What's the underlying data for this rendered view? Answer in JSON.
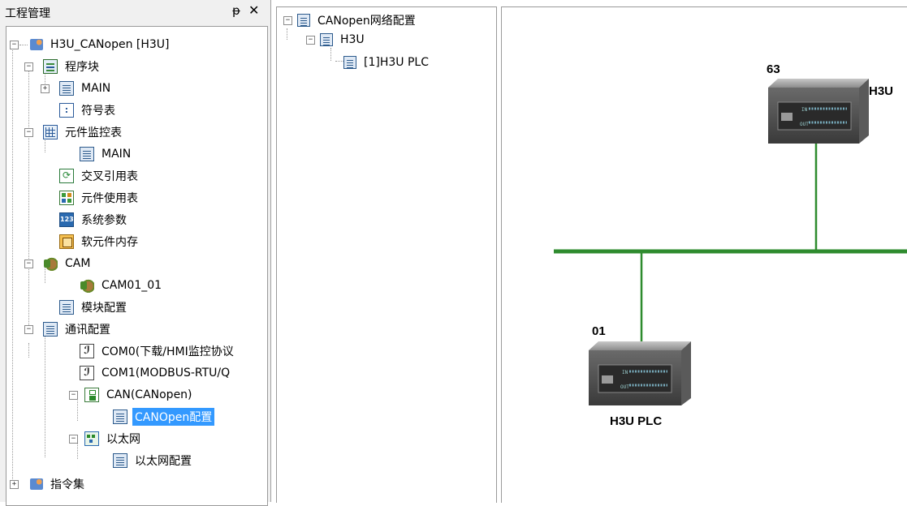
{
  "project_panel": {
    "title": "工程管理",
    "pin_glyph": "ᵽ",
    "close_glyph": "✕",
    "tree": [
      {
        "id": "root",
        "label": "H3U_CANopen [H3U]",
        "icon": "project-icon",
        "expander": "−"
      },
      {
        "id": "prog",
        "label": "程序块",
        "icon": "program-block-icon",
        "expander": "−"
      },
      {
        "id": "main1",
        "label": "MAIN",
        "icon": "document-icon",
        "expander": "+"
      },
      {
        "id": "sym",
        "label": "符号表",
        "icon": "symbol-table-icon"
      },
      {
        "id": "mon",
        "label": "元件监控表",
        "icon": "monitor-table-icon",
        "expander": "−"
      },
      {
        "id": "main2",
        "label": "MAIN",
        "icon": "document-icon"
      },
      {
        "id": "xref",
        "label": "交叉引用表",
        "icon": "cross-reference-icon"
      },
      {
        "id": "use",
        "label": "元件使用表",
        "icon": "usage-table-icon"
      },
      {
        "id": "param",
        "label": "系统参数",
        "icon": "system-param-icon"
      },
      {
        "id": "mem",
        "label": "软元件内存",
        "icon": "soft-memory-icon"
      },
      {
        "id": "cam",
        "label": "CAM",
        "icon": "cam-icon",
        "expander": "−"
      },
      {
        "id": "cam01",
        "label": "CAM01_01",
        "icon": "cam-icon"
      },
      {
        "id": "mod",
        "label": "模块配置",
        "icon": "document-icon"
      },
      {
        "id": "comm",
        "label": "通讯配置",
        "icon": "document-icon",
        "expander": "−"
      },
      {
        "id": "com0",
        "label": "COM0(下载/HMI监控协议",
        "icon": "com-port-icon"
      },
      {
        "id": "com1",
        "label": "COM1(MODBUS-RTU/Q",
        "icon": "com-port-icon"
      },
      {
        "id": "can",
        "label": "CAN(CANopen)",
        "icon": "can-icon",
        "expander": "−"
      },
      {
        "id": "canopen",
        "label": "CANOpen配置",
        "icon": "document-icon",
        "selected": true
      },
      {
        "id": "eth",
        "label": "以太网",
        "icon": "ethernet-icon",
        "expander": "−"
      },
      {
        "id": "ethcfg",
        "label": "以太网配置",
        "icon": "document-icon"
      },
      {
        "id": "inst",
        "label": "指令集",
        "icon": "instruction-set-icon",
        "expander": "+"
      }
    ]
  },
  "network_tree": {
    "nodes": [
      {
        "label": "CANopen网络配置",
        "expander": "−"
      },
      {
        "label": "H3U",
        "expander": "−"
      },
      {
        "label": "[1]H3U PLC"
      }
    ]
  },
  "network_canvas": {
    "bus_color": "#2e8b2e",
    "stations": [
      {
        "number": "63",
        "name": "H3U"
      },
      {
        "number": "01",
        "name": "H3U PLC"
      }
    ]
  }
}
